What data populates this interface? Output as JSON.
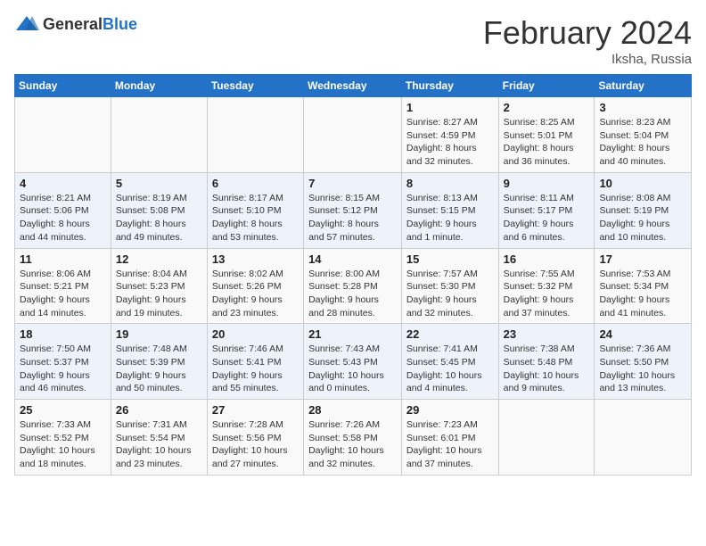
{
  "header": {
    "logo_general": "General",
    "logo_blue": "Blue",
    "month_year": "February 2024",
    "location": "Iksha, Russia"
  },
  "weekdays": [
    "Sunday",
    "Monday",
    "Tuesday",
    "Wednesday",
    "Thursday",
    "Friday",
    "Saturday"
  ],
  "weeks": [
    [
      {
        "day": "",
        "info": ""
      },
      {
        "day": "",
        "info": ""
      },
      {
        "day": "",
        "info": ""
      },
      {
        "day": "",
        "info": ""
      },
      {
        "day": "1",
        "info": "Sunrise: 8:27 AM\nSunset: 4:59 PM\nDaylight: 8 hours\nand 32 minutes."
      },
      {
        "day": "2",
        "info": "Sunrise: 8:25 AM\nSunset: 5:01 PM\nDaylight: 8 hours\nand 36 minutes."
      },
      {
        "day": "3",
        "info": "Sunrise: 8:23 AM\nSunset: 5:04 PM\nDaylight: 8 hours\nand 40 minutes."
      }
    ],
    [
      {
        "day": "4",
        "info": "Sunrise: 8:21 AM\nSunset: 5:06 PM\nDaylight: 8 hours\nand 44 minutes."
      },
      {
        "day": "5",
        "info": "Sunrise: 8:19 AM\nSunset: 5:08 PM\nDaylight: 8 hours\nand 49 minutes."
      },
      {
        "day": "6",
        "info": "Sunrise: 8:17 AM\nSunset: 5:10 PM\nDaylight: 8 hours\nand 53 minutes."
      },
      {
        "day": "7",
        "info": "Sunrise: 8:15 AM\nSunset: 5:12 PM\nDaylight: 8 hours\nand 57 minutes."
      },
      {
        "day": "8",
        "info": "Sunrise: 8:13 AM\nSunset: 5:15 PM\nDaylight: 9 hours\nand 1 minute."
      },
      {
        "day": "9",
        "info": "Sunrise: 8:11 AM\nSunset: 5:17 PM\nDaylight: 9 hours\nand 6 minutes."
      },
      {
        "day": "10",
        "info": "Sunrise: 8:08 AM\nSunset: 5:19 PM\nDaylight: 9 hours\nand 10 minutes."
      }
    ],
    [
      {
        "day": "11",
        "info": "Sunrise: 8:06 AM\nSunset: 5:21 PM\nDaylight: 9 hours\nand 14 minutes."
      },
      {
        "day": "12",
        "info": "Sunrise: 8:04 AM\nSunset: 5:23 PM\nDaylight: 9 hours\nand 19 minutes."
      },
      {
        "day": "13",
        "info": "Sunrise: 8:02 AM\nSunset: 5:26 PM\nDaylight: 9 hours\nand 23 minutes."
      },
      {
        "day": "14",
        "info": "Sunrise: 8:00 AM\nSunset: 5:28 PM\nDaylight: 9 hours\nand 28 minutes."
      },
      {
        "day": "15",
        "info": "Sunrise: 7:57 AM\nSunset: 5:30 PM\nDaylight: 9 hours\nand 32 minutes."
      },
      {
        "day": "16",
        "info": "Sunrise: 7:55 AM\nSunset: 5:32 PM\nDaylight: 9 hours\nand 37 minutes."
      },
      {
        "day": "17",
        "info": "Sunrise: 7:53 AM\nSunset: 5:34 PM\nDaylight: 9 hours\nand 41 minutes."
      }
    ],
    [
      {
        "day": "18",
        "info": "Sunrise: 7:50 AM\nSunset: 5:37 PM\nDaylight: 9 hours\nand 46 minutes."
      },
      {
        "day": "19",
        "info": "Sunrise: 7:48 AM\nSunset: 5:39 PM\nDaylight: 9 hours\nand 50 minutes."
      },
      {
        "day": "20",
        "info": "Sunrise: 7:46 AM\nSunset: 5:41 PM\nDaylight: 9 hours\nand 55 minutes."
      },
      {
        "day": "21",
        "info": "Sunrise: 7:43 AM\nSunset: 5:43 PM\nDaylight: 10 hours\nand 0 minutes."
      },
      {
        "day": "22",
        "info": "Sunrise: 7:41 AM\nSunset: 5:45 PM\nDaylight: 10 hours\nand 4 minutes."
      },
      {
        "day": "23",
        "info": "Sunrise: 7:38 AM\nSunset: 5:48 PM\nDaylight: 10 hours\nand 9 minutes."
      },
      {
        "day": "24",
        "info": "Sunrise: 7:36 AM\nSunset: 5:50 PM\nDaylight: 10 hours\nand 13 minutes."
      }
    ],
    [
      {
        "day": "25",
        "info": "Sunrise: 7:33 AM\nSunset: 5:52 PM\nDaylight: 10 hours\nand 18 minutes."
      },
      {
        "day": "26",
        "info": "Sunrise: 7:31 AM\nSunset: 5:54 PM\nDaylight: 10 hours\nand 23 minutes."
      },
      {
        "day": "27",
        "info": "Sunrise: 7:28 AM\nSunset: 5:56 PM\nDaylight: 10 hours\nand 27 minutes."
      },
      {
        "day": "28",
        "info": "Sunrise: 7:26 AM\nSunset: 5:58 PM\nDaylight: 10 hours\nand 32 minutes."
      },
      {
        "day": "29",
        "info": "Sunrise: 7:23 AM\nSunset: 6:01 PM\nDaylight: 10 hours\nand 37 minutes."
      },
      {
        "day": "",
        "info": ""
      },
      {
        "day": "",
        "info": ""
      }
    ]
  ]
}
